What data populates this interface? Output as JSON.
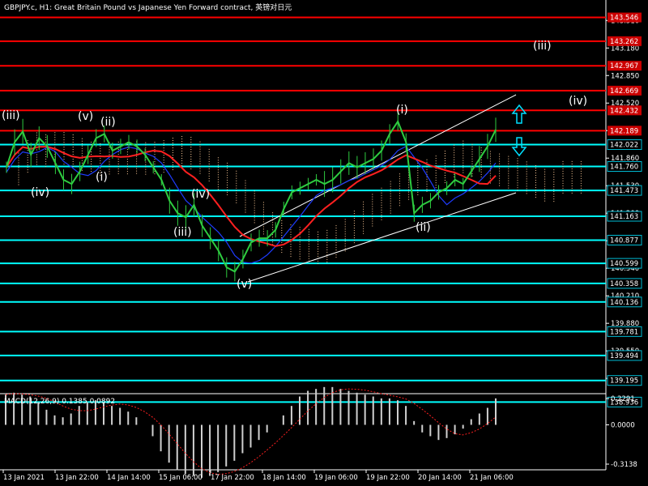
{
  "window": {
    "title": "GBPJPY.c, H1:  Great Britain Pound vs Japanese Yen Forward contract, 英镑对日元"
  },
  "colors": {
    "background": "#000000",
    "resistance_line": "#ff0000",
    "support_line": "#00ffff",
    "price_green": "#2ecc40",
    "ma_red": "#ff2020",
    "ma_blue": "#1e3cff",
    "label_red": "#cc0000",
    "label_cyan": "#00bcd4",
    "cloud": "#ffcc99",
    "macd_hist": "#d0d0d0",
    "macd_signal": "#ff2020"
  },
  "chart_data": [
    {
      "type": "line",
      "title": "GBPJPY.c, H1:  Great Britain Pound vs Japanese Yen Forward contract, 英镑对日元",
      "ylim": [
        138.8,
        143.8
      ],
      "y_ticks": [
        "143.510",
        "143.180",
        "142.850",
        "142.520",
        "142.190",
        "141.860",
        "141.530",
        "141.200",
        "140.870",
        "140.540",
        "140.210",
        "139.880",
        "139.550",
        "139.220"
      ],
      "x_ticks": [
        "13 Jan 2021",
        "13 Jan 22:00",
        "14 Jan 14:00",
        "15 Jan 06:00",
        "17 Jan 22:00",
        "18 Jan 14:00",
        "19 Jan 06:00",
        "19 Jan 22:00",
        "20 Jan 14:00",
        "21 Jan 06:00"
      ],
      "resistance_levels": [
        {
          "label": "143.546",
          "value": 143.546
        },
        {
          "label": "143.262",
          "value": 143.262
        },
        {
          "label": "142.967",
          "value": 142.967
        },
        {
          "label": "142.669",
          "value": 142.669
        },
        {
          "label": "142.432",
          "value": 142.432
        },
        {
          "label": "142.189",
          "value": 142.189
        }
      ],
      "support_levels": [
        {
          "label": "142.022",
          "value": 142.022
        },
        {
          "label": "141.760",
          "value": 141.76
        },
        {
          "label": "141.473",
          "value": 141.473
        },
        {
          "label": "141.163",
          "value": 141.163
        },
        {
          "label": "140.877",
          "value": 140.877
        },
        {
          "label": "140.599",
          "value": 140.599
        },
        {
          "label": "140.358",
          "value": 140.358
        },
        {
          "label": "140.136",
          "value": 140.136
        },
        {
          "label": "139.781",
          "value": 139.781
        },
        {
          "label": "139.494",
          "value": 139.494
        },
        {
          "label": "139.195",
          "value": 139.195
        },
        {
          "label": "138.936",
          "value": 138.936
        }
      ],
      "price_series": {
        "values": [
          141.75,
          142.05,
          142.18,
          141.9,
          142.1,
          142.0,
          141.8,
          141.6,
          141.55,
          141.7,
          141.9,
          142.1,
          142.15,
          141.95,
          142.0,
          142.05,
          142.0,
          141.9,
          141.75,
          141.6,
          141.35,
          141.2,
          141.15,
          141.3,
          141.05,
          140.9,
          140.75,
          140.55,
          140.5,
          140.65,
          140.85,
          140.9,
          140.9,
          141.0,
          141.25,
          141.45,
          141.5,
          141.55,
          141.6,
          141.55,
          141.6,
          141.7,
          141.8,
          141.75,
          141.8,
          141.85,
          141.95,
          142.15,
          142.3,
          142.05,
          141.2,
          141.3,
          141.35,
          141.45,
          141.5,
          141.6,
          141.55,
          141.7,
          141.85,
          142.0,
          142.2
        ]
      },
      "wave_labels": [
        "(iii)",
        "(v)",
        "(ii)",
        "(i)",
        "(iv)",
        "(iv)",
        "(iii)",
        "(v)",
        "(i)",
        "(ii)",
        "(iv)",
        "(iii)"
      ]
    },
    {
      "type": "bar",
      "title": "MACD(12,26,9) 0.1385 0.0892",
      "ylim": [
        -0.3138,
        0.2291
      ],
      "y_ticks": [
        "0.2291",
        "0.0000",
        "-0.3138"
      ],
      "histogram_values": [
        0.16,
        0.17,
        0.16,
        0.15,
        0.12,
        0.08,
        0.05,
        0.04,
        0.06,
        0.1,
        0.12,
        0.13,
        0.12,
        0.1,
        0.09,
        0.07,
        0.04,
        0.0,
        -0.06,
        -0.14,
        -0.2,
        -0.24,
        -0.26,
        -0.27,
        -0.28,
        -0.27,
        -0.25,
        -0.22,
        -0.19,
        -0.15,
        -0.12,
        -0.08,
        -0.04,
        0.0,
        0.05,
        0.1,
        0.15,
        0.18,
        0.19,
        0.2,
        0.2,
        0.19,
        0.18,
        0.17,
        0.16,
        0.15,
        0.14,
        0.14,
        0.13,
        0.1,
        0.02,
        -0.04,
        -0.06,
        -0.08,
        -0.07,
        -0.05,
        -0.02,
        0.03,
        0.06,
        0.09,
        0.14
      ]
    }
  ]
}
